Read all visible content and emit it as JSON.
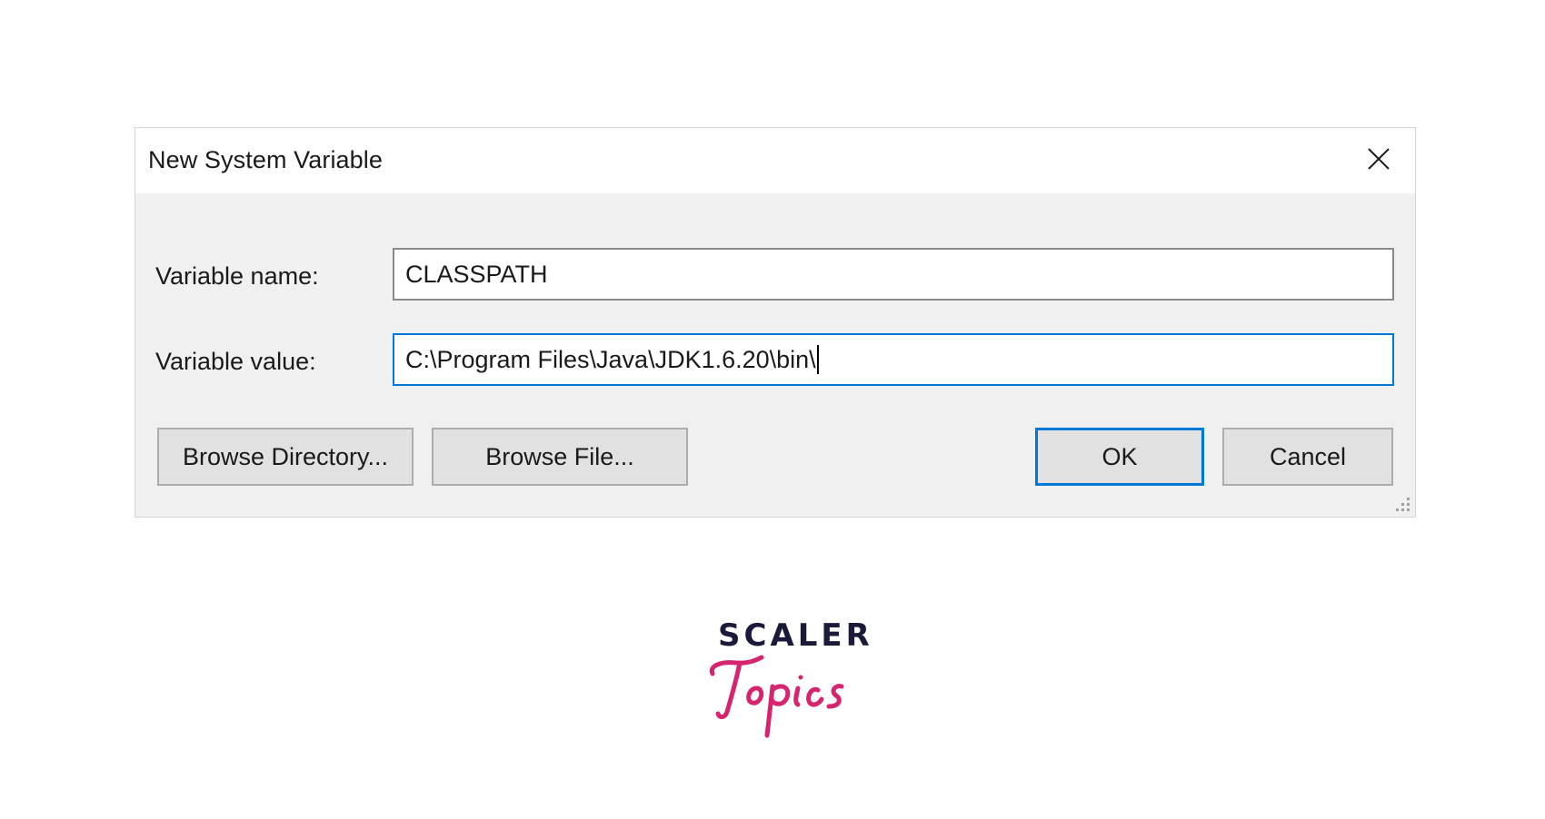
{
  "dialog": {
    "title": "New System Variable",
    "close_icon": "close-icon",
    "fields": {
      "name_label": "Variable name:",
      "name_value": "CLASSPATH",
      "value_label": "Variable value:",
      "value_value": "C:\\Program Files\\Java\\JDK1.6.20\\bin\\"
    },
    "buttons": {
      "browse_directory": "Browse Directory...",
      "browse_file": "Browse File...",
      "ok": "OK",
      "cancel": "Cancel"
    }
  },
  "logo": {
    "word_top": "SCALER",
    "word_bottom": "Topics",
    "colors": {
      "top": "#1b1a3a",
      "bottom": "#d6246e"
    }
  },
  "colors": {
    "accent": "#0078d7",
    "dialog_bg": "#f0f0f0",
    "button_bg": "#e1e1e1"
  }
}
